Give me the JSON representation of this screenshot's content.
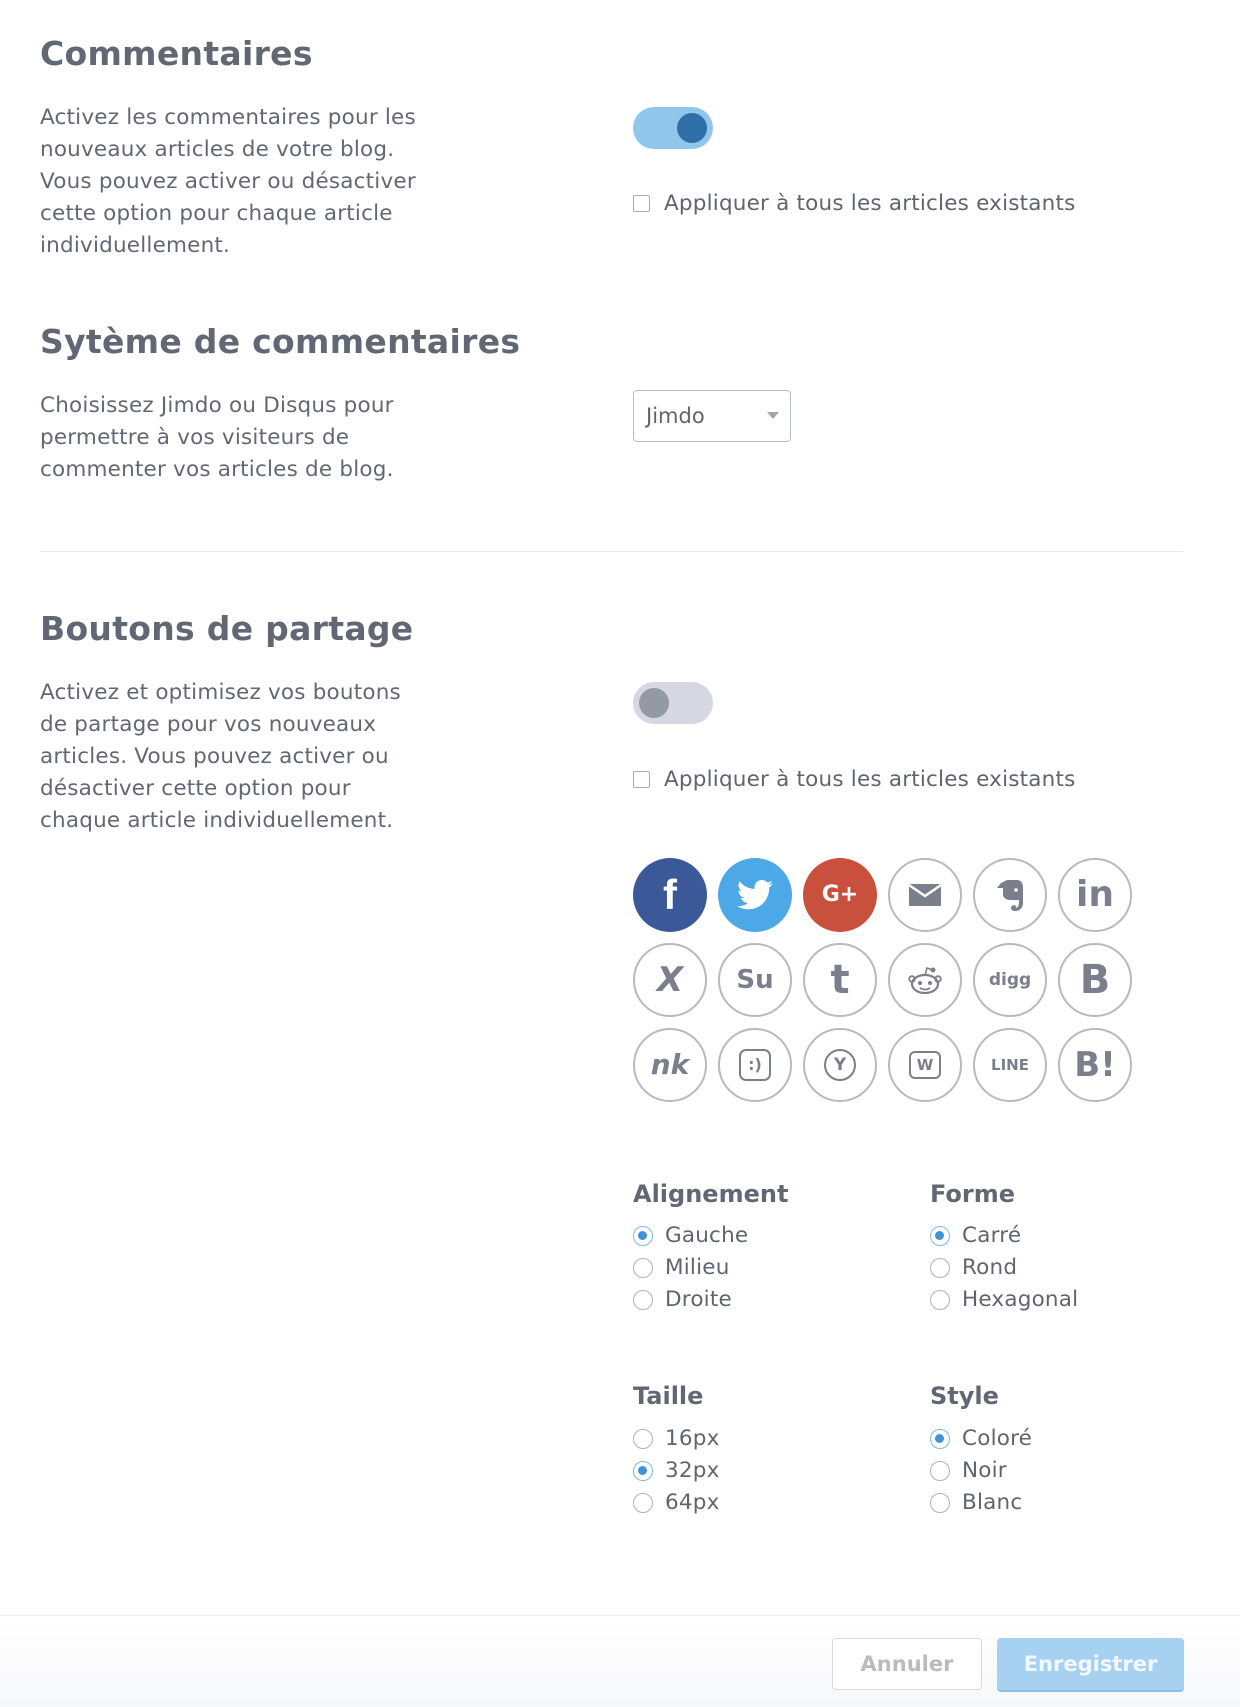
{
  "comments": {
    "title": "Commentaires",
    "description": "Activez les commentaires pour les nouveaux articles de votre blog. Vous pouvez activer ou désactiver cette option pour chaque article individuellement.",
    "toggle_on": true,
    "apply_all_label": "Appliquer à tous les articles existants"
  },
  "comment_system": {
    "title": "Sytème de commentaires",
    "description": "Choisissez Jimdo ou Disqus pour permettre à vos visiteurs de commenter vos articles de blog.",
    "selected": "Jimdo"
  },
  "share": {
    "title": "Boutons de partage",
    "description": "Activez et optimisez vos boutons de partage pour vos nouveaux articles. Vous pouvez activer ou désactiver cette option pour chaque article individuellement.",
    "toggle_on": false,
    "apply_all_label": "Appliquer à tous les articles existants",
    "icons": [
      {
        "name": "facebook-icon",
        "glyph": "f",
        "color": "#3b5998",
        "filled": true
      },
      {
        "name": "twitter-icon",
        "glyph": "",
        "color": "#4ca8e6",
        "filled": true
      },
      {
        "name": "google-plus-icon",
        "glyph": "G+",
        "color": "#c9503c",
        "filled": true
      },
      {
        "name": "email-icon",
        "glyph": "",
        "color": "",
        "filled": false
      },
      {
        "name": "evernote-icon",
        "glyph": "",
        "color": "",
        "filled": false
      },
      {
        "name": "linkedin-icon",
        "glyph": "in",
        "color": "",
        "filled": false
      },
      {
        "name": "xing-icon",
        "glyph": "X",
        "color": "",
        "filled": false
      },
      {
        "name": "stumbleupon-icon",
        "glyph": "Su",
        "color": "",
        "filled": false
      },
      {
        "name": "tumblr-icon",
        "glyph": "t",
        "color": "",
        "filled": false
      },
      {
        "name": "reddit-icon",
        "glyph": "",
        "color": "",
        "filled": false
      },
      {
        "name": "digg-icon",
        "glyph": "digg",
        "color": "",
        "filled": false
      },
      {
        "name": "blogger-icon",
        "glyph": "B",
        "color": "",
        "filled": false
      },
      {
        "name": "nk-icon",
        "glyph": "nk",
        "color": "",
        "filled": false
      },
      {
        "name": "buzz-icon",
        "glyph": ":)",
        "color": "",
        "filled": false
      },
      {
        "name": "yammer-icon",
        "glyph": "Y",
        "color": "",
        "filled": false
      },
      {
        "name": "weibo-icon",
        "glyph": "W",
        "color": "",
        "filled": false
      },
      {
        "name": "line-icon",
        "glyph": "LINE",
        "color": "",
        "filled": false
      },
      {
        "name": "hatena-icon",
        "glyph": "B!",
        "color": "",
        "filled": false
      }
    ]
  },
  "options": {
    "alignment": {
      "title": "Alignement",
      "options": [
        "Gauche",
        "Milieu",
        "Droite"
      ],
      "selected": 0
    },
    "shape": {
      "title": "Forme",
      "options": [
        "Carré",
        "Rond",
        "Hexagonal"
      ],
      "selected": 0
    },
    "size": {
      "title": "Taille",
      "options": [
        "16px",
        "32px",
        "64px"
      ],
      "selected": 1
    },
    "style": {
      "title": "Style",
      "options": [
        "Coloré",
        "Noir",
        "Blanc"
      ],
      "selected": 0
    }
  },
  "footer": {
    "cancel_label": "Annuler",
    "save_label": "Enregistrer"
  }
}
